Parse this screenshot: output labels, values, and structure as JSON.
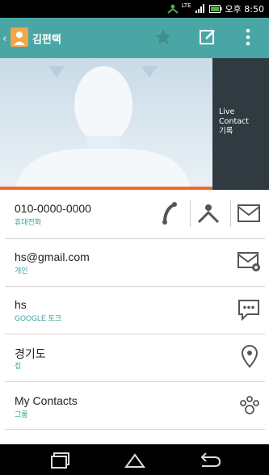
{
  "status_bar": {
    "network_label": "LTE",
    "time": "오후 8:50",
    "icons": [
      "user-sync-icon",
      "signal-icon",
      "battery-icon"
    ]
  },
  "action_bar": {
    "contact_name": "김편택",
    "icons": [
      "back-chevron-icon",
      "star-icon",
      "edit-icon",
      "overflow-menu-icon"
    ]
  },
  "live_contact": {
    "line1": "Live",
    "line2": "Contact",
    "line3": "기록"
  },
  "details": [
    {
      "title": "010-0000-0000",
      "subtitle": "휴대전화",
      "actions": [
        "phone-icon",
        "person-icon",
        "message-icon"
      ]
    },
    {
      "title": "hs@gmail.com",
      "subtitle": "개인",
      "actions": [
        "email-icon"
      ]
    },
    {
      "title": "hs",
      "subtitle": "GOOGLE 토크",
      "actions": [
        "chat-icon"
      ]
    },
    {
      "title": "경기도",
      "subtitle": "집",
      "actions": [
        "map-pin-icon"
      ]
    },
    {
      "title": "My Contacts",
      "subtitle": "그룹",
      "actions": [
        "group-icon"
      ]
    }
  ],
  "nav_bar": {
    "icons": [
      "recent-apps-icon",
      "home-icon",
      "back-icon"
    ]
  },
  "colors": {
    "action_bar": "#4aa6a4",
    "accent": "#f26b2a",
    "subtitle": "#3aa09a"
  }
}
